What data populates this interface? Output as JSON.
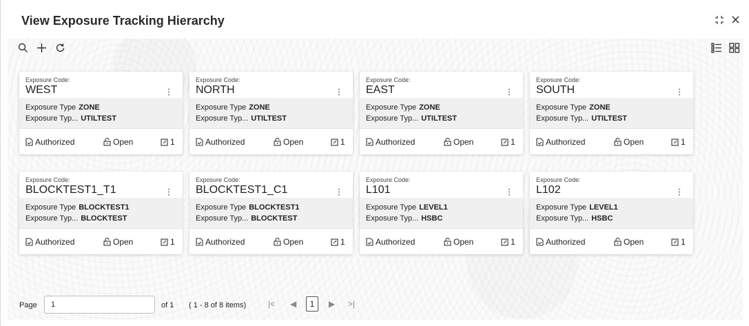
{
  "header": {
    "title": "View Exposure Tracking Hierarchy",
    "icons": [
      "restore-icon",
      "close-icon"
    ]
  },
  "toolbar": {
    "icons": [
      "search-icon",
      "add-icon",
      "refresh-icon",
      "list-view-icon",
      "tile-view-icon"
    ]
  },
  "labels": {
    "code": "Exposure Code:",
    "type": "Exposure Type",
    "type_desc": "Exposure Typ..."
  },
  "cards": [
    {
      "code": "WEST",
      "type": "ZONE",
      "type_desc": "UTILTEST",
      "status": "Authorized",
      "lock": "Open",
      "edits": "1"
    },
    {
      "code": "NORTH",
      "type": "ZONE",
      "type_desc": "UTILTEST",
      "status": "Authorized",
      "lock": "Open",
      "edits": "1"
    },
    {
      "code": "EAST",
      "type": "ZONE",
      "type_desc": "UTILTEST",
      "status": "Authorized",
      "lock": "Open",
      "edits": "1"
    },
    {
      "code": "SOUTH",
      "type": "ZONE",
      "type_desc": "UTILTEST",
      "status": "Authorized",
      "lock": "Open",
      "edits": "1"
    },
    {
      "code": "BLOCKTEST1_T1",
      "type": "BLOCKTEST1",
      "type_desc": "BLOCKTEST",
      "status": "Authorized",
      "lock": "Open",
      "edits": "1"
    },
    {
      "code": "BLOCKTEST1_C1",
      "type": "BLOCKTEST1",
      "type_desc": "BLOCKTEST",
      "status": "Authorized",
      "lock": "Open",
      "edits": "1"
    },
    {
      "code": "L101",
      "type": "LEVEL1",
      "type_desc": "HSBC",
      "status": "Authorized",
      "lock": "Open",
      "edits": "1"
    },
    {
      "code": "L102",
      "type": "LEVEL1",
      "type_desc": "HSBC",
      "status": "Authorized",
      "lock": "Open",
      "edits": "1"
    }
  ],
  "pager": {
    "label": "Page",
    "value": "1",
    "of": "of 1",
    "range": "( 1 - 8 of 8 items)",
    "current": "1"
  }
}
